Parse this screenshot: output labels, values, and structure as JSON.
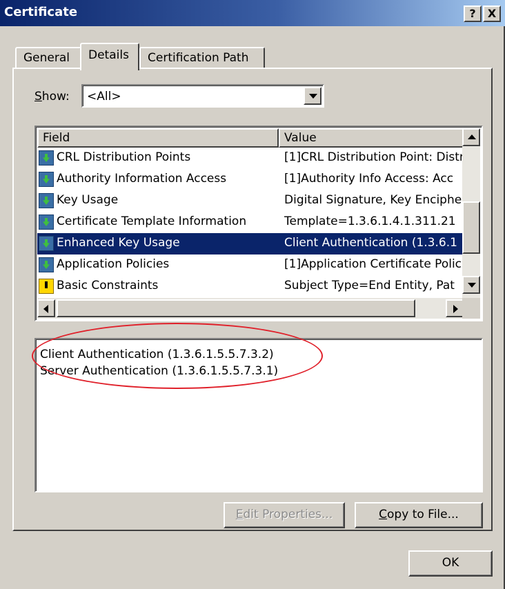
{
  "window": {
    "title": "Certificate",
    "help_label": "?",
    "close_label": "X"
  },
  "tabs": [
    {
      "label": "General",
      "active": false
    },
    {
      "label": "Details",
      "active": true
    },
    {
      "label": "Certification Path",
      "active": false
    }
  ],
  "show": {
    "label_prefix": "S",
    "label_rest": "how:",
    "selected": "<All>"
  },
  "list": {
    "columns": [
      "Field",
      "Value"
    ],
    "rows": [
      {
        "field": "CRL Distribution Points",
        "value": "[1]CRL Distribution Point: Distr",
        "icon": "certificate-extension-icon"
      },
      {
        "field": "Authority Information Access",
        "value": "[1]Authority Info Access: Acc",
        "icon": "certificate-extension-icon"
      },
      {
        "field": "Key Usage",
        "value": "Digital Signature, Key Enciphe",
        "icon": "certificate-extension-icon"
      },
      {
        "field": "Certificate Template Information",
        "value": "Template=1.3.6.1.4.1.311.21",
        "icon": "certificate-extension-icon"
      },
      {
        "field": "Enhanced Key Usage",
        "value": "Client Authentication (1.3.6.1",
        "icon": "certificate-extension-icon",
        "selected": true
      },
      {
        "field": "Application Policies",
        "value": "[1]Application Certificate Polic",
        "icon": "certificate-extension-icon"
      },
      {
        "field": "Basic Constraints",
        "value": "Subject Type=End Entity, Pat",
        "icon": "critical-extension-warning-icon"
      }
    ]
  },
  "detail": {
    "lines": [
      "Client Authentication (1.3.6.1.5.5.7.3.2)",
      "Server Authentication (1.3.6.1.5.5.7.3.1)"
    ]
  },
  "buttons": {
    "edit_prefix": "E",
    "edit_rest": "dit Properties...",
    "copy_prefix": "C",
    "copy_rest": "opy to File...",
    "ok": "OK"
  },
  "colors": {
    "selection": "#0a246a",
    "highlight_ellipse": "#e0202a",
    "face": "#d4d0c8"
  }
}
